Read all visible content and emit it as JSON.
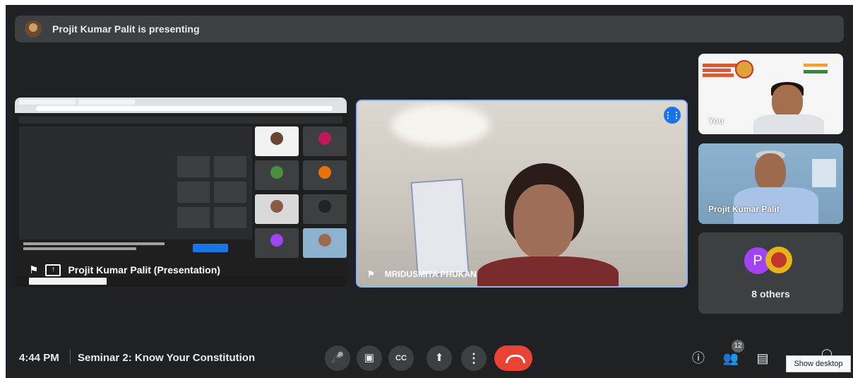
{
  "banner": {
    "text": "Projit Kumar Palit is presenting"
  },
  "presentation_tile": {
    "label": "Projit Kumar Palit (Presentation)"
  },
  "speaker_tile": {
    "name": "MRIDUSMITA PHUKAN"
  },
  "self_tile": {
    "label": "You"
  },
  "participant_tile": {
    "name": "Projit Kumar Palit"
  },
  "others_tile": {
    "avatar_letter": "P",
    "count_label": "8 others"
  },
  "bottom_bar": {
    "time": "4:44 PM",
    "meeting_title": "Seminar 2: Know Your Constitution",
    "people_count": "12"
  },
  "tooltip": {
    "text": "Show desktop"
  },
  "colors": {
    "background": "#202124",
    "tile": "#3c4043",
    "end_call": "#ea4335",
    "accent": "#1a73e8"
  }
}
